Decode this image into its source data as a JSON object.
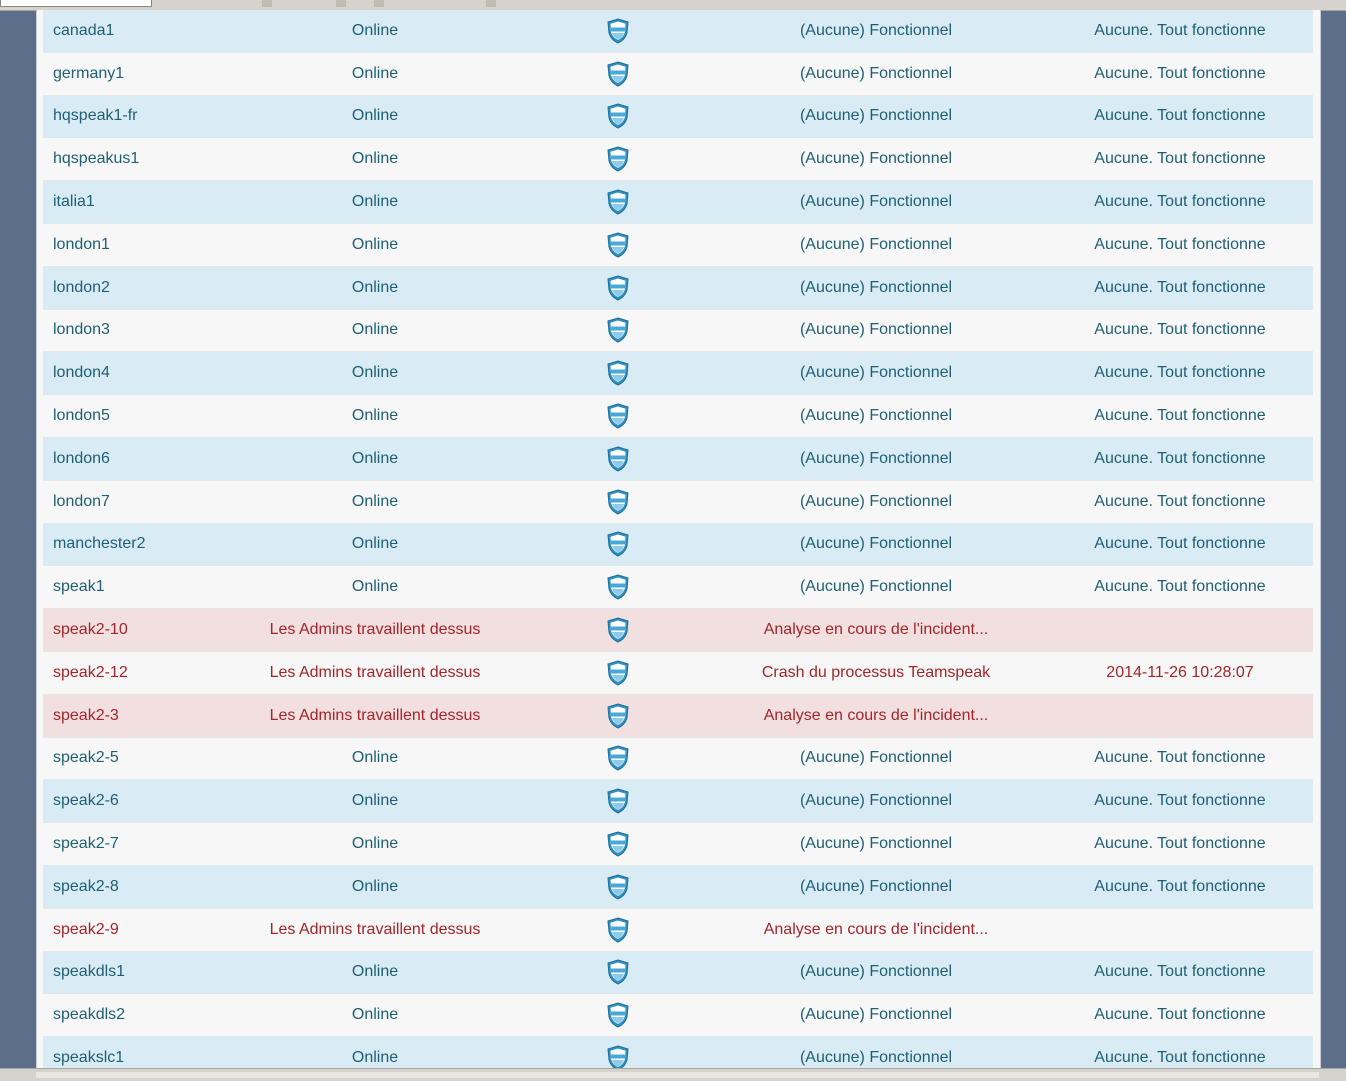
{
  "colors": {
    "row_alt": "#d9ecf6",
    "row_plain": "#f7f7f7",
    "row_error_alt": "#f2dfe0",
    "text_ok": "#1e5f73",
    "text_error": "#a3252a",
    "background": "#5d6e8b"
  },
  "rows": [
    {
      "name": "canada1",
      "status": "Online",
      "icon": "shield-icon",
      "issue": "(Aucune) Fonctionnel",
      "info": "Aucune. Tout fonctionne",
      "state": "ok",
      "shade": "alt"
    },
    {
      "name": "germany1",
      "status": "Online",
      "icon": "shield-icon",
      "issue": "(Aucune) Fonctionnel",
      "info": "Aucune. Tout fonctionne",
      "state": "ok",
      "shade": "plain"
    },
    {
      "name": "hqspeak1-fr",
      "status": "Online",
      "icon": "shield-icon",
      "issue": "(Aucune) Fonctionnel",
      "info": "Aucune. Tout fonctionne",
      "state": "ok",
      "shade": "alt"
    },
    {
      "name": "hqspeakus1",
      "status": "Online",
      "icon": "shield-icon",
      "issue": "(Aucune) Fonctionnel",
      "info": "Aucune. Tout fonctionne",
      "state": "ok",
      "shade": "plain"
    },
    {
      "name": "italia1",
      "status": "Online",
      "icon": "shield-icon",
      "issue": "(Aucune) Fonctionnel",
      "info": "Aucune. Tout fonctionne",
      "state": "ok",
      "shade": "alt"
    },
    {
      "name": "london1",
      "status": "Online",
      "icon": "shield-icon",
      "issue": "(Aucune) Fonctionnel",
      "info": "Aucune. Tout fonctionne",
      "state": "ok",
      "shade": "plain"
    },
    {
      "name": "london2",
      "status": "Online",
      "icon": "shield-icon",
      "issue": "(Aucune) Fonctionnel",
      "info": "Aucune. Tout fonctionne",
      "state": "ok",
      "shade": "alt"
    },
    {
      "name": "london3",
      "status": "Online",
      "icon": "shield-icon",
      "issue": "(Aucune) Fonctionnel",
      "info": "Aucune. Tout fonctionne",
      "state": "ok",
      "shade": "plain"
    },
    {
      "name": "london4",
      "status": "Online",
      "icon": "shield-icon",
      "issue": "(Aucune) Fonctionnel",
      "info": "Aucune. Tout fonctionne",
      "state": "ok",
      "shade": "alt"
    },
    {
      "name": "london5",
      "status": "Online",
      "icon": "shield-icon",
      "issue": "(Aucune) Fonctionnel",
      "info": "Aucune. Tout fonctionne",
      "state": "ok",
      "shade": "plain"
    },
    {
      "name": "london6",
      "status": "Online",
      "icon": "shield-icon",
      "issue": "(Aucune) Fonctionnel",
      "info": "Aucune. Tout fonctionne",
      "state": "ok",
      "shade": "alt"
    },
    {
      "name": "london7",
      "status": "Online",
      "icon": "shield-icon",
      "issue": "(Aucune) Fonctionnel",
      "info": "Aucune. Tout fonctionne",
      "state": "ok",
      "shade": "plain"
    },
    {
      "name": "manchester2",
      "status": "Online",
      "icon": "shield-icon",
      "issue": "(Aucune) Fonctionnel",
      "info": "Aucune. Tout fonctionne",
      "state": "ok",
      "shade": "alt"
    },
    {
      "name": "speak1",
      "status": "Online",
      "icon": "shield-icon",
      "issue": "(Aucune) Fonctionnel",
      "info": "Aucune. Tout fonctionne",
      "state": "ok",
      "shade": "plain"
    },
    {
      "name": "speak2-10",
      "status": "Les Admins travaillent dessus",
      "icon": "shield-icon",
      "issue": "Analyse en cours de l'incident...",
      "info": "",
      "state": "err",
      "shade": "alt"
    },
    {
      "name": "speak2-12",
      "status": "Les Admins travaillent dessus",
      "icon": "shield-icon",
      "issue": "Crash du processus Teamspeak",
      "info": "2014-11-26 10:28:07",
      "state": "err",
      "shade": "plain"
    },
    {
      "name": "speak2-3",
      "status": "Les Admins travaillent dessus",
      "icon": "shield-icon",
      "issue": "Analyse en cours de l'incident...",
      "info": "",
      "state": "err",
      "shade": "alt"
    },
    {
      "name": "speak2-5",
      "status": "Online",
      "icon": "shield-icon",
      "issue": "(Aucune) Fonctionnel",
      "info": "Aucune. Tout fonctionne",
      "state": "ok",
      "shade": "plain"
    },
    {
      "name": "speak2-6",
      "status": "Online",
      "icon": "shield-icon",
      "issue": "(Aucune) Fonctionnel",
      "info": "Aucune. Tout fonctionne",
      "state": "ok",
      "shade": "alt"
    },
    {
      "name": "speak2-7",
      "status": "Online",
      "icon": "shield-icon",
      "issue": "(Aucune) Fonctionnel",
      "info": "Aucune. Tout fonctionne",
      "state": "ok",
      "shade": "plain"
    },
    {
      "name": "speak2-8",
      "status": "Online",
      "icon": "shield-icon",
      "issue": "(Aucune) Fonctionnel",
      "info": "Aucune. Tout fonctionne",
      "state": "ok",
      "shade": "alt"
    },
    {
      "name": "speak2-9",
      "status": "Les Admins travaillent dessus",
      "icon": "shield-icon",
      "issue": "Analyse en cours de l'incident...",
      "info": "",
      "state": "err",
      "shade": "plain"
    },
    {
      "name": "speakdls1",
      "status": "Online",
      "icon": "shield-icon",
      "issue": "(Aucune) Fonctionnel",
      "info": "Aucune. Tout fonctionne",
      "state": "ok",
      "shade": "alt"
    },
    {
      "name": "speakdls2",
      "status": "Online",
      "icon": "shield-icon",
      "issue": "(Aucune) Fonctionnel",
      "info": "Aucune. Tout fonctionne",
      "state": "ok",
      "shade": "plain"
    },
    {
      "name": "speakslc1",
      "status": "Online",
      "icon": "shield-icon",
      "issue": "(Aucune) Fonctionnel",
      "info": "Aucune. Tout fonctionne",
      "state": "ok",
      "shade": "alt"
    }
  ]
}
